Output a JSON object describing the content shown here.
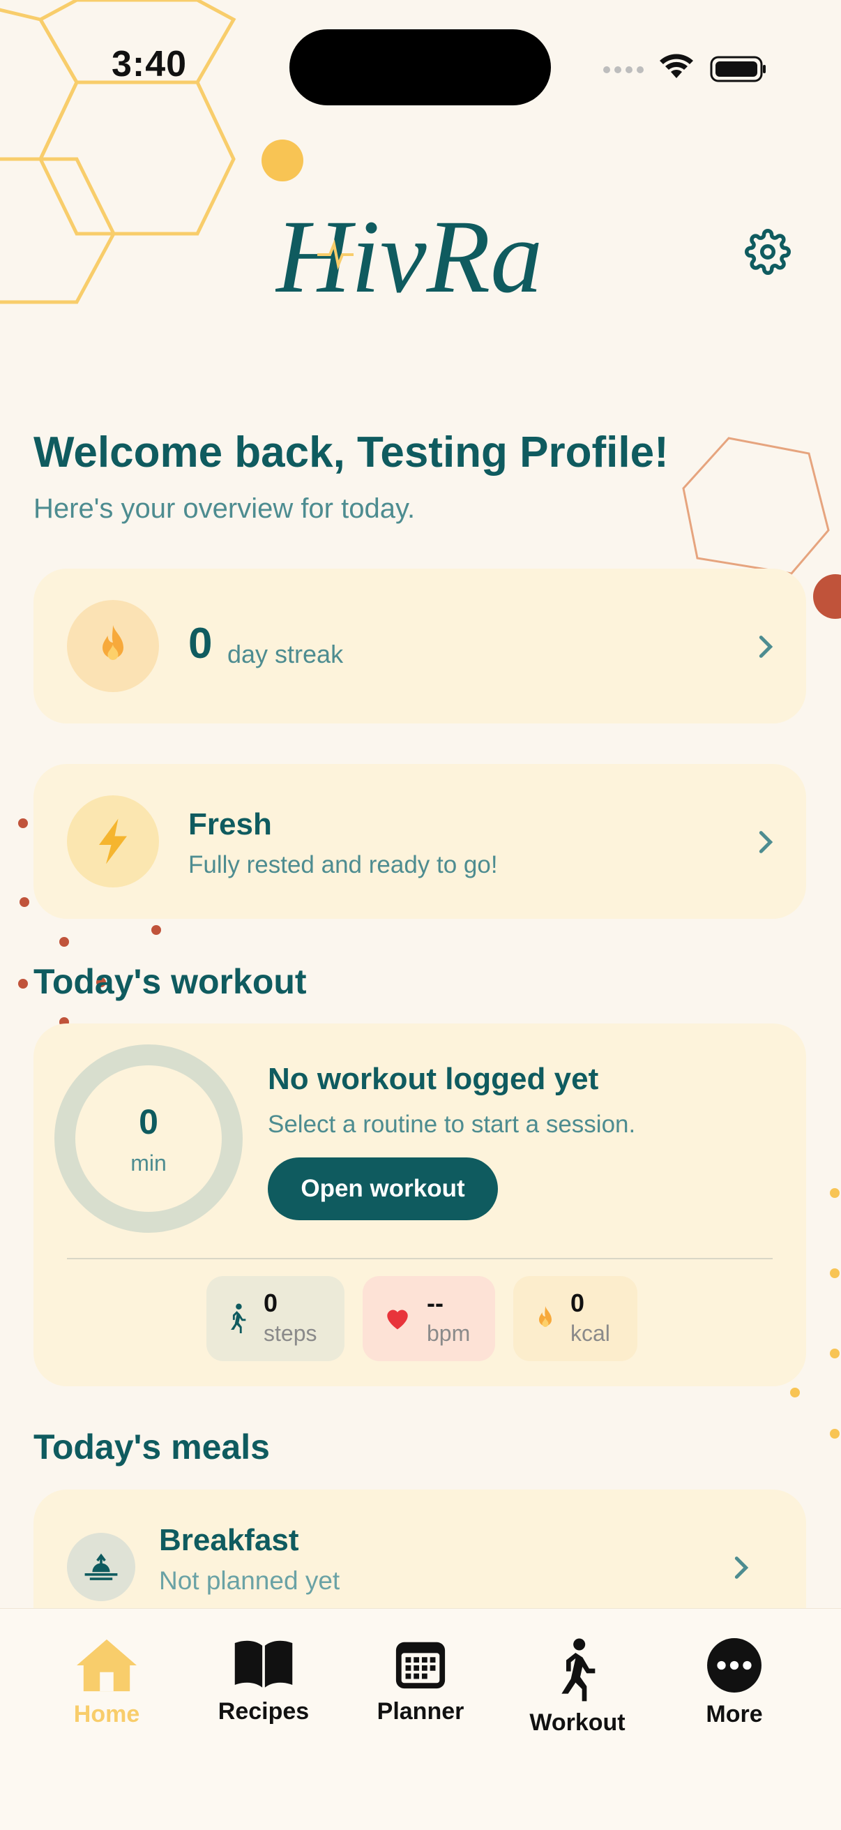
{
  "status_bar": {
    "time": "3:40"
  },
  "header": {
    "brand": "HivRa"
  },
  "welcome": {
    "title": "Welcome back, Testing Profile!",
    "subtitle": "Here's your overview for today."
  },
  "streak": {
    "count": "0",
    "label": "day streak"
  },
  "energy": {
    "title": "Fresh",
    "subtitle": "Fully rested and ready to go!"
  },
  "workout": {
    "section_title": "Today's workout",
    "ring_value": "0",
    "ring_unit": "min",
    "title": "No workout logged yet",
    "subtitle": "Select a routine to start a session.",
    "button": "Open workout",
    "stats": [
      {
        "value": "0",
        "unit": "steps",
        "icon": "walking-icon"
      },
      {
        "value": "--",
        "unit": "bpm",
        "icon": "heart-icon"
      },
      {
        "value": "0",
        "unit": "kcal",
        "icon": "flame-icon"
      }
    ]
  },
  "meals": {
    "section_title": "Today's meals",
    "items": [
      {
        "title": "Breakfast",
        "subtitle": "Not planned yet",
        "icon": "sunrise-icon"
      }
    ]
  },
  "tabs": [
    {
      "label": "Home",
      "icon": "home-icon",
      "active": true
    },
    {
      "label": "Recipes",
      "icon": "book-icon",
      "active": false
    },
    {
      "label": "Planner",
      "icon": "calendar-icon",
      "active": false
    },
    {
      "label": "Workout",
      "icon": "walking-icon",
      "active": false
    },
    {
      "label": "More",
      "icon": "more-icon",
      "active": false
    }
  ],
  "colors": {
    "primary": "#0f5b5f",
    "accent": "#f8cd6b",
    "card": "#fdf3db",
    "background": "#fbf6ee",
    "decor_red": "#c0533a"
  }
}
